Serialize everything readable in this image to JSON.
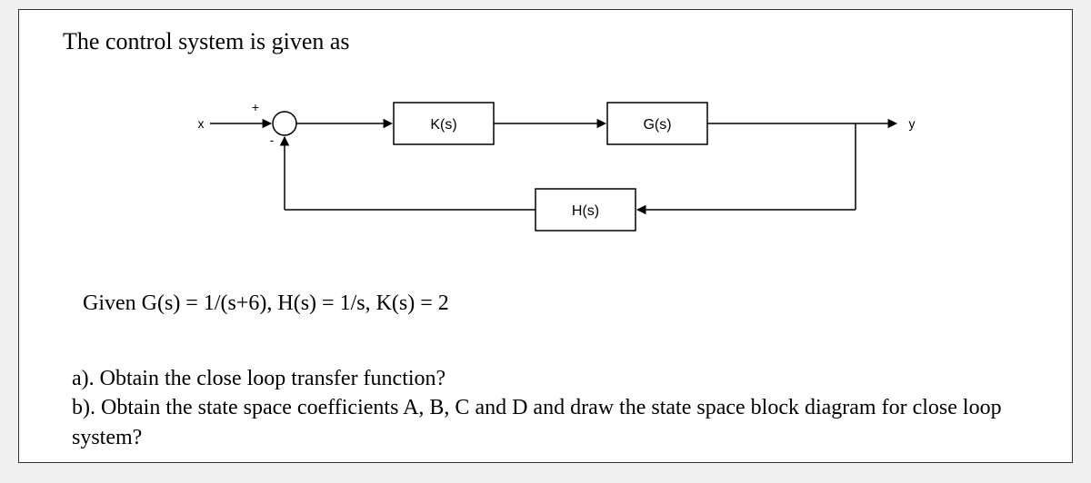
{
  "title": "The control system is given as",
  "diagram": {
    "input_label": "x",
    "output_label": "y",
    "plus_sign": "+",
    "minus_sign": "-",
    "blocks": {
      "K": "K(s)",
      "G": "G(s)",
      "H": "H(s)"
    }
  },
  "given_line": "Given G(s) = 1/(s+6), H(s) = 1/s, K(s) = 2",
  "question_a": "a). Obtain the close loop transfer function?",
  "question_b": "b). Obtain the state space coefficients A, B, C and D and draw the state space block diagram for close loop system?"
}
